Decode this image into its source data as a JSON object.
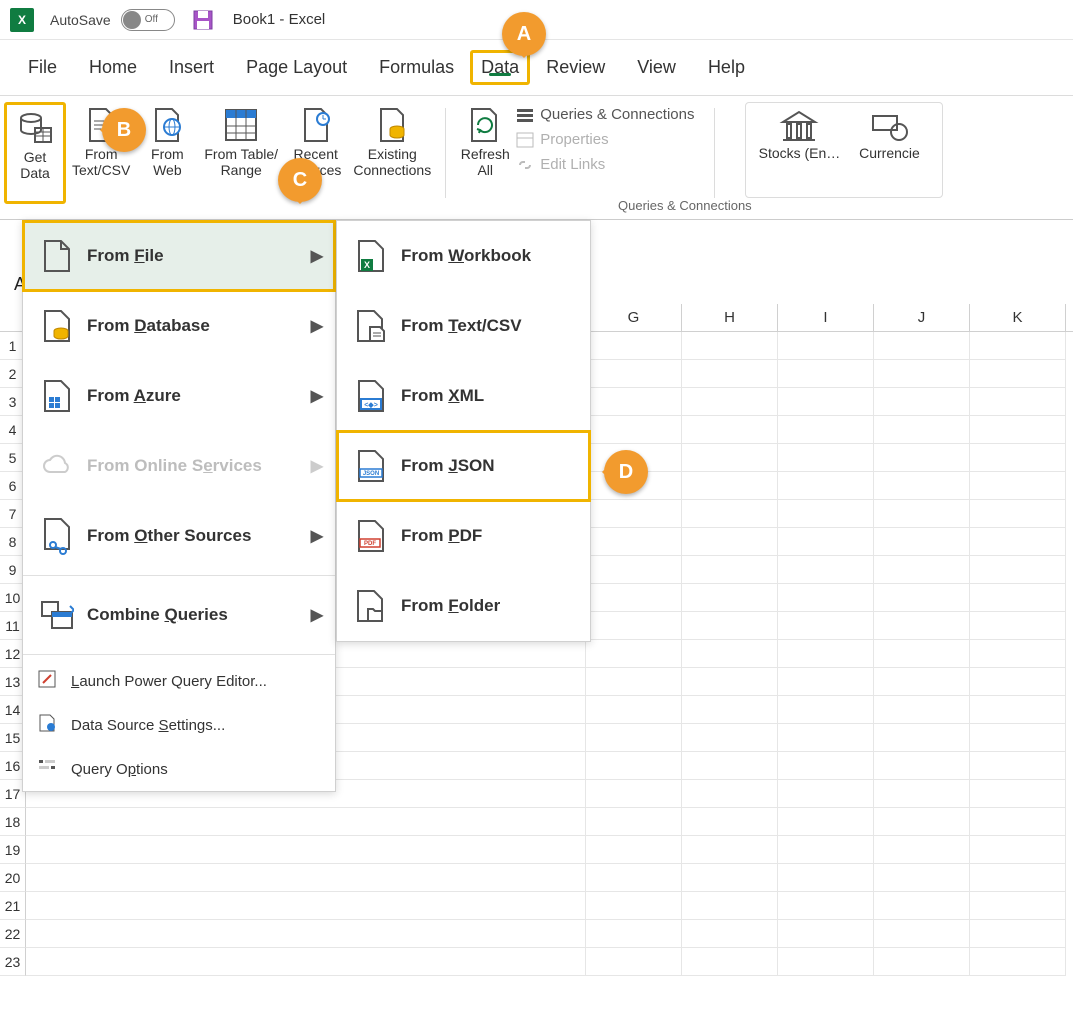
{
  "title": {
    "autosave": "AutoSave",
    "toggle": "Off",
    "doc": "Book1  -  Excel"
  },
  "tabs": [
    "File",
    "Home",
    "Insert",
    "Page Layout",
    "Formulas",
    "Data",
    "Review",
    "View",
    "Help"
  ],
  "active_tab": "Data",
  "ribbon": {
    "get_data": "Get\nData",
    "from_textcsv": "From\nText/CSV",
    "from_web": "From\nWeb",
    "from_range": "From Table/\nRange",
    "recent_sources": "Recent\nSources",
    "existing_conn": "Existing\nConnections",
    "refresh_all": "Refresh\nAll",
    "qc1": "Queries & Connections",
    "qc2": "Properties",
    "qc3": "Edit Links",
    "qc_label": "Queries & Connections",
    "stocks": "Stocks (En…",
    "currencies": "Currencie"
  },
  "menu1": {
    "from_file": "From File",
    "from_db": "From Database",
    "from_azure": "From Azure",
    "from_online": "From Online Services",
    "from_other": "From Other Sources",
    "combine": "Combine Queries",
    "launch_pq": "Launch Power Query Editor...",
    "ds_settings": "Data Source Settings...",
    "q_options": "Query Options"
  },
  "menu2": {
    "from_wb": "From Workbook",
    "from_text": "From Text/CSV",
    "from_xml": "From XML",
    "from_json": "From JSON",
    "from_pdf": "From PDF",
    "from_folder": "From Folder"
  },
  "cols": [
    "G",
    "H",
    "I",
    "J",
    "K"
  ],
  "rowcount": 23,
  "namebox": "A",
  "badges": {
    "A": "A",
    "B": "B",
    "C": "C",
    "D": "D"
  }
}
